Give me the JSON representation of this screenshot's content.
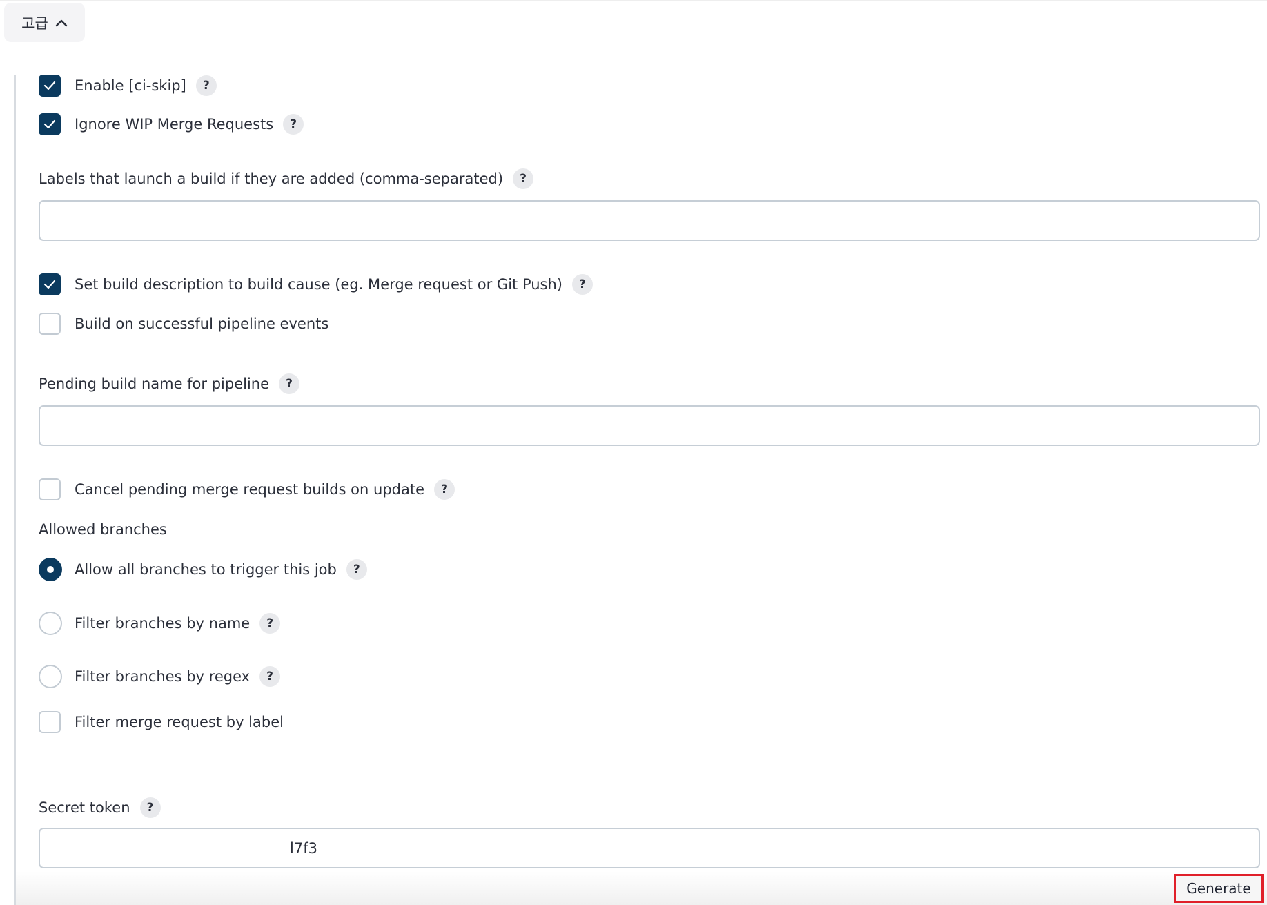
{
  "advanced": {
    "label": "고급",
    "expanded": true
  },
  "options": {
    "enable_ci_skip": {
      "label": "Enable [ci-skip]",
      "checked": true
    },
    "ignore_wip": {
      "label": "Ignore WIP Merge Requests",
      "checked": true
    },
    "labels_field": {
      "label": "Labels that launch a build if they are added (comma-separated)",
      "value": ""
    },
    "set_build_description": {
      "label": "Set build description to build cause (eg. Merge request or Git Push)",
      "checked": true
    },
    "build_on_pipeline": {
      "label": "Build on successful pipeline events",
      "checked": false
    },
    "pending_build_name": {
      "label": "Pending build name for pipeline",
      "value": ""
    },
    "cancel_pending": {
      "label": "Cancel pending merge request builds on update",
      "checked": false
    }
  },
  "allowed_branches": {
    "label": "Allowed branches",
    "options": [
      {
        "label": "Allow all branches to trigger this job",
        "selected": true
      },
      {
        "label": "Filter branches by name",
        "selected": false
      },
      {
        "label": "Filter branches by regex",
        "selected": false
      }
    ],
    "filter_by_label": {
      "label": "Filter merge request by label",
      "checked": false
    }
  },
  "secret_token": {
    "label": "Secret token",
    "value": "l7f3"
  },
  "generate_button": {
    "label": "Generate"
  },
  "help_glyph": "?",
  "colors": {
    "accent": "#0b3a5e",
    "highlight": "#e0202a"
  }
}
